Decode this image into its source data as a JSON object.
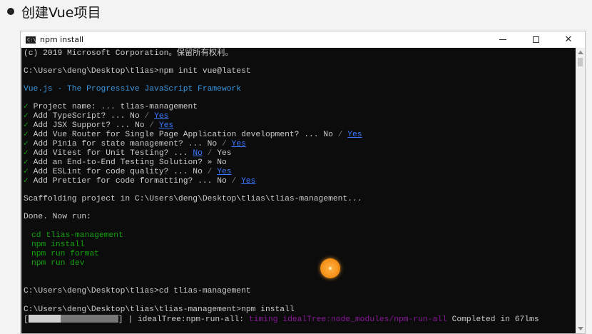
{
  "slide": {
    "heading": "创建Vue项目"
  },
  "window": {
    "title": "npm install",
    "icon_label": "C:\\",
    "controls": {
      "minimize": "minimize",
      "maximize": "maximize",
      "close": "✕"
    }
  },
  "console": {
    "copyright": "(c) 2019 Microsoft Corporation。保留所有权利。",
    "prompt1": "C:\\Users\\deng\\Desktop\\tlias>npm init vue@latest",
    "vue_banner": "Vue.js - The Progressive JavaScript Framework",
    "questions": [
      {
        "check": "✓",
        "text": " Project name: ... tlias-management"
      },
      {
        "check": "✓",
        "text": " Add TypeScript? ... No ",
        "slash": "/ ",
        "answer": "Yes"
      },
      {
        "check": "✓",
        "text": " Add JSX Support? ... No ",
        "slash": "/ ",
        "answer": "Yes"
      },
      {
        "check": "✓",
        "text": " Add Vue Router for Single Page Application development? ... No ",
        "slash": "/ ",
        "answer": "Yes"
      },
      {
        "check": "✓",
        "text": " Add Pinia for state management? ... No ",
        "slash": "/ ",
        "answer": "Yes"
      },
      {
        "check": "✓",
        "text": " Add Vitest for Unit Testing? ... ",
        "answer": "No",
        "slash": " / ",
        "after": "Yes"
      },
      {
        "check": "✓",
        "text": " Add an End-to-End Testing Solution? » No"
      },
      {
        "check": "✓",
        "text": " Add ESLint for code quality? ... No ",
        "slash": "/ ",
        "answer": "Yes"
      },
      {
        "check": "✓",
        "text": " Add Prettier for code formatting? ... No ",
        "slash": "/ ",
        "answer": "Yes"
      }
    ],
    "scaffolding": "Scaffolding project in C:\\Users\\deng\\Desktop\\tlias\\tlias-management...",
    "done": "Done. Now run:",
    "next_steps": [
      "cd tlias-management",
      "npm install",
      "npm run format",
      "npm run dev"
    ],
    "prompt2": "C:\\Users\\deng\\Desktop\\tlias>cd tlias-management",
    "prompt3": "C:\\Users\\deng\\Desktop\\tlias\\tlias-management>npm install",
    "progress": {
      "open": "[",
      "close": "] | idealTree:npm-run-all: ",
      "timing": "timing",
      "tree": "idealTree:node_modules/npm-run-all",
      "completed": "Completed in 67lms"
    }
  },
  "colors": {
    "console_bg": "#0c0c0c",
    "text": "#cccccc",
    "green": "#13a10e",
    "cyan": "#3a96dd",
    "link": "#3b78ff",
    "magenta": "#881798"
  }
}
